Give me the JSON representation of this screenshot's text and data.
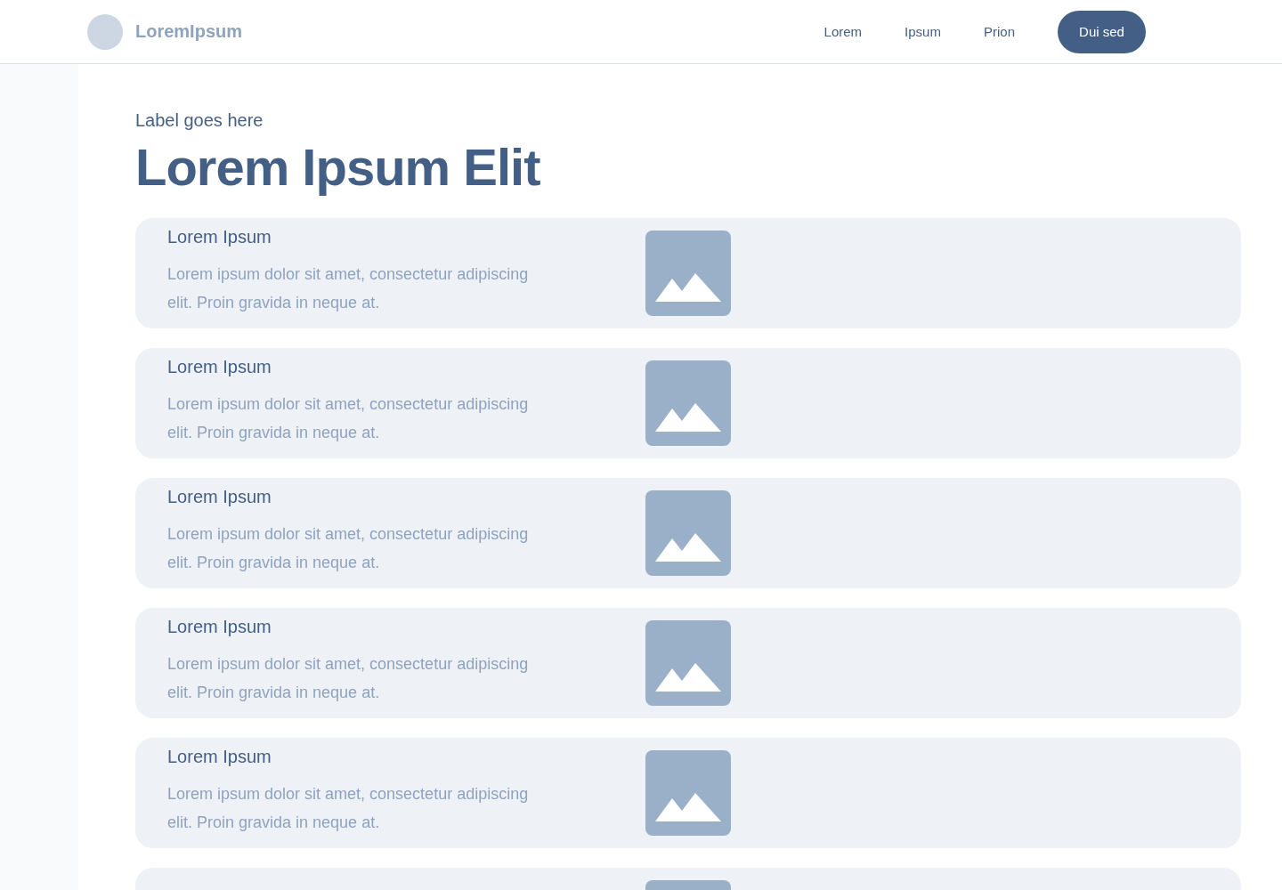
{
  "header": {
    "logo_text": "LoremIpsum",
    "nav": [
      "Lorem",
      "Ipsum",
      "Prion"
    ],
    "cta": "Dui sed"
  },
  "label": "Label goes here",
  "title": "Lorem Ipsum Elit",
  "cards": [
    {
      "title": "Lorem Ipsum",
      "body": "Lorem ipsum dolor sit amet, consectetur adipiscing elit. Proin gravida in neque at."
    },
    {
      "title": "Lorem Ipsum",
      "body": "Lorem ipsum dolor sit amet, consectetur adipiscing elit. Proin gravida in neque at."
    },
    {
      "title": "Lorem Ipsum",
      "body": "Lorem ipsum dolor sit amet, consectetur adipiscing elit. Proin gravida in neque at."
    },
    {
      "title": "Lorem Ipsum",
      "body": "Lorem ipsum dolor sit amet, consectetur adipiscing elit. Proin gravida in neque at."
    },
    {
      "title": "Lorem Ipsum",
      "body": "Lorem ipsum dolor sit amet, consectetur adipiscing elit. Proin gravida in neque at."
    }
  ]
}
